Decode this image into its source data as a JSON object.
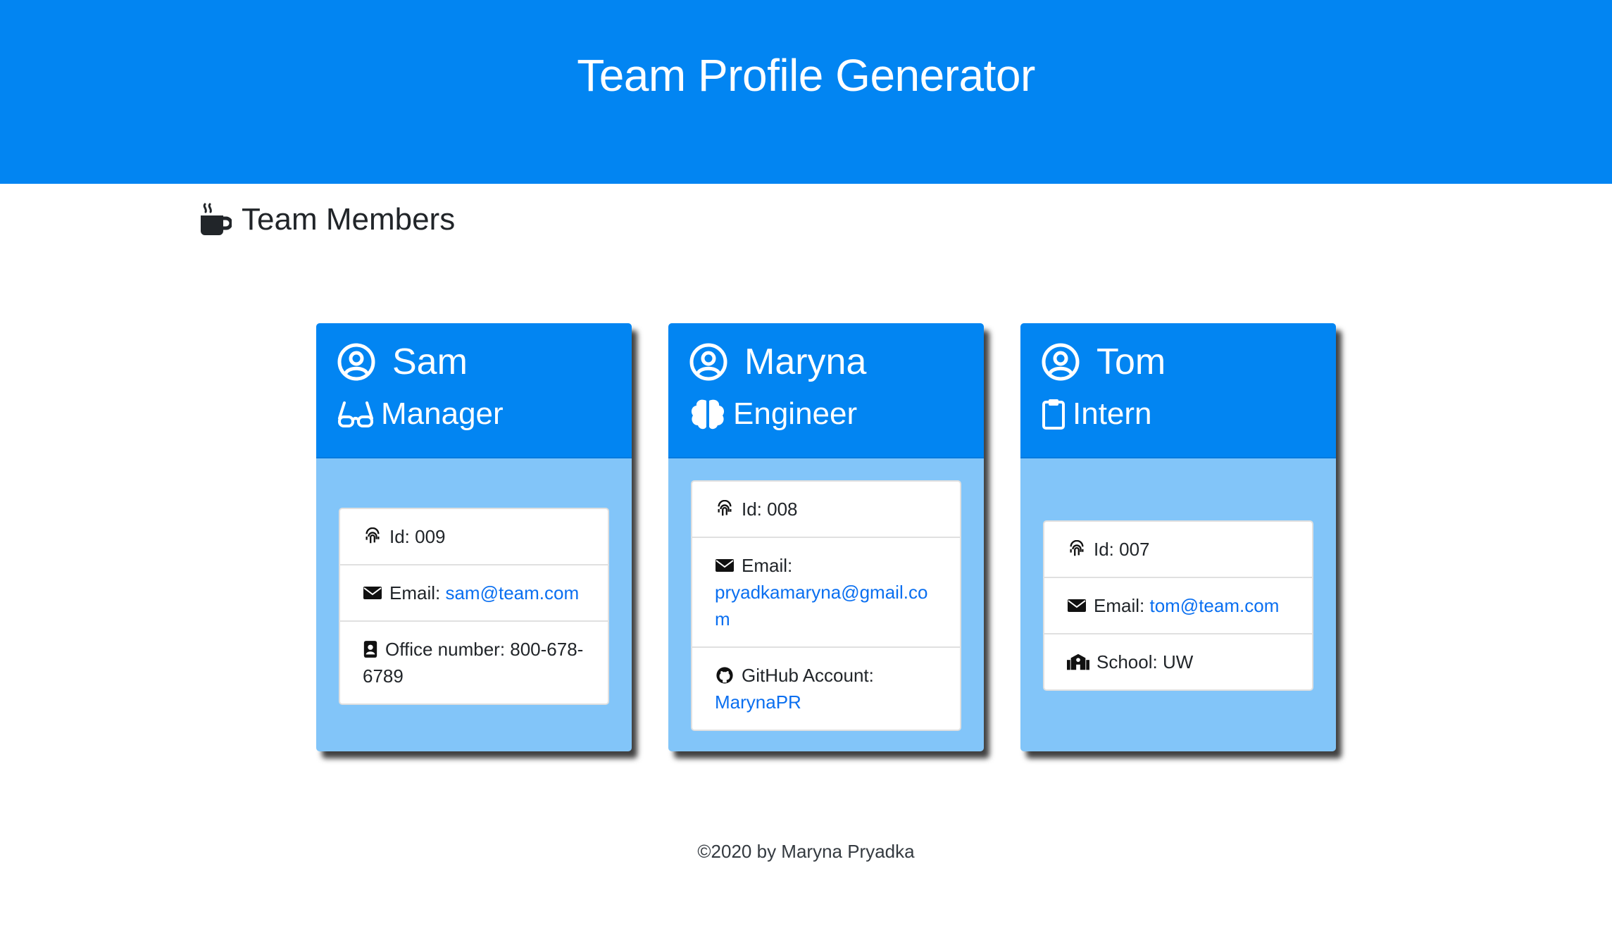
{
  "header": {
    "title": "Team Profile Generator"
  },
  "section": {
    "title": "Team Members"
  },
  "cards": [
    {
      "name": "Sam",
      "role": "Manager",
      "id_text": "Id: 009",
      "email_label": "Email: ",
      "email": "sam@team.com",
      "extra_text": "Office number: 800-678-6789"
    },
    {
      "name": "Maryna",
      "role": "Engineer",
      "id_text": "Id: 008",
      "email_label": "Email: ",
      "email": "pryadkamaryna@gmail.com",
      "github_label": "GitHub Account: ",
      "github": "MarynaPR"
    },
    {
      "name": "Tom",
      "role": "Intern",
      "id_text": "Id: 007",
      "email_label": "Email: ",
      "email": "tom@team.com",
      "extra_text": "School: UW"
    }
  ],
  "footer": {
    "text": "©2020 by Maryna Pryadka"
  },
  "colors": {
    "primary": "#0285f2",
    "card_body": "#82c5f9",
    "link": "#0a6ff0"
  }
}
